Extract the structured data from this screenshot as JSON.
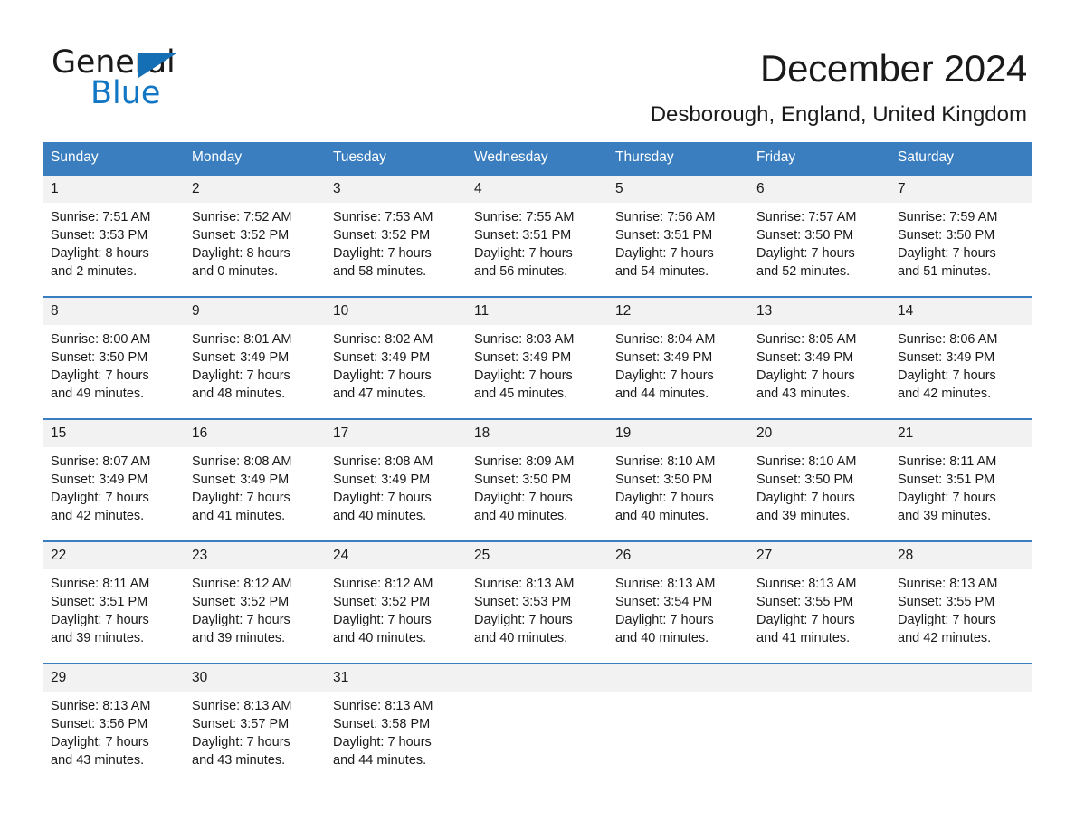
{
  "brand": {
    "name_part1": "General",
    "name_part2": "Blue",
    "accent_color": "#1176c4",
    "triangle_color": "#156fb5"
  },
  "header": {
    "title": "December 2024",
    "subtitle": "Desborough, England, United Kingdom"
  },
  "calendar": {
    "header_bg": "#3a7ebf",
    "daynum_bg": "#f2f2f2",
    "weekday_headers": [
      "Sunday",
      "Monday",
      "Tuesday",
      "Wednesday",
      "Thursday",
      "Friday",
      "Saturday"
    ],
    "weeks": [
      [
        {
          "day": "1",
          "sunrise": "Sunrise: 7:51 AM",
          "sunset": "Sunset: 3:53 PM",
          "daylight_line1": "Daylight: 8 hours",
          "daylight_line2": "and 2 minutes."
        },
        {
          "day": "2",
          "sunrise": "Sunrise: 7:52 AM",
          "sunset": "Sunset: 3:52 PM",
          "daylight_line1": "Daylight: 8 hours",
          "daylight_line2": "and 0 minutes."
        },
        {
          "day": "3",
          "sunrise": "Sunrise: 7:53 AM",
          "sunset": "Sunset: 3:52 PM",
          "daylight_line1": "Daylight: 7 hours",
          "daylight_line2": "and 58 minutes."
        },
        {
          "day": "4",
          "sunrise": "Sunrise: 7:55 AM",
          "sunset": "Sunset: 3:51 PM",
          "daylight_line1": "Daylight: 7 hours",
          "daylight_line2": "and 56 minutes."
        },
        {
          "day": "5",
          "sunrise": "Sunrise: 7:56 AM",
          "sunset": "Sunset: 3:51 PM",
          "daylight_line1": "Daylight: 7 hours",
          "daylight_line2": "and 54 minutes."
        },
        {
          "day": "6",
          "sunrise": "Sunrise: 7:57 AM",
          "sunset": "Sunset: 3:50 PM",
          "daylight_line1": "Daylight: 7 hours",
          "daylight_line2": "and 52 minutes."
        },
        {
          "day": "7",
          "sunrise": "Sunrise: 7:59 AM",
          "sunset": "Sunset: 3:50 PM",
          "daylight_line1": "Daylight: 7 hours",
          "daylight_line2": "and 51 minutes."
        }
      ],
      [
        {
          "day": "8",
          "sunrise": "Sunrise: 8:00 AM",
          "sunset": "Sunset: 3:50 PM",
          "daylight_line1": "Daylight: 7 hours",
          "daylight_line2": "and 49 minutes."
        },
        {
          "day": "9",
          "sunrise": "Sunrise: 8:01 AM",
          "sunset": "Sunset: 3:49 PM",
          "daylight_line1": "Daylight: 7 hours",
          "daylight_line2": "and 48 minutes."
        },
        {
          "day": "10",
          "sunrise": "Sunrise: 8:02 AM",
          "sunset": "Sunset: 3:49 PM",
          "daylight_line1": "Daylight: 7 hours",
          "daylight_line2": "and 47 minutes."
        },
        {
          "day": "11",
          "sunrise": "Sunrise: 8:03 AM",
          "sunset": "Sunset: 3:49 PM",
          "daylight_line1": "Daylight: 7 hours",
          "daylight_line2": "and 45 minutes."
        },
        {
          "day": "12",
          "sunrise": "Sunrise: 8:04 AM",
          "sunset": "Sunset: 3:49 PM",
          "daylight_line1": "Daylight: 7 hours",
          "daylight_line2": "and 44 minutes."
        },
        {
          "day": "13",
          "sunrise": "Sunrise: 8:05 AM",
          "sunset": "Sunset: 3:49 PM",
          "daylight_line1": "Daylight: 7 hours",
          "daylight_line2": "and 43 minutes."
        },
        {
          "day": "14",
          "sunrise": "Sunrise: 8:06 AM",
          "sunset": "Sunset: 3:49 PM",
          "daylight_line1": "Daylight: 7 hours",
          "daylight_line2": "and 42 minutes."
        }
      ],
      [
        {
          "day": "15",
          "sunrise": "Sunrise: 8:07 AM",
          "sunset": "Sunset: 3:49 PM",
          "daylight_line1": "Daylight: 7 hours",
          "daylight_line2": "and 42 minutes."
        },
        {
          "day": "16",
          "sunrise": "Sunrise: 8:08 AM",
          "sunset": "Sunset: 3:49 PM",
          "daylight_line1": "Daylight: 7 hours",
          "daylight_line2": "and 41 minutes."
        },
        {
          "day": "17",
          "sunrise": "Sunrise: 8:08 AM",
          "sunset": "Sunset: 3:49 PM",
          "daylight_line1": "Daylight: 7 hours",
          "daylight_line2": "and 40 minutes."
        },
        {
          "day": "18",
          "sunrise": "Sunrise: 8:09 AM",
          "sunset": "Sunset: 3:50 PM",
          "daylight_line1": "Daylight: 7 hours",
          "daylight_line2": "and 40 minutes."
        },
        {
          "day": "19",
          "sunrise": "Sunrise: 8:10 AM",
          "sunset": "Sunset: 3:50 PM",
          "daylight_line1": "Daylight: 7 hours",
          "daylight_line2": "and 40 minutes."
        },
        {
          "day": "20",
          "sunrise": "Sunrise: 8:10 AM",
          "sunset": "Sunset: 3:50 PM",
          "daylight_line1": "Daylight: 7 hours",
          "daylight_line2": "and 39 minutes."
        },
        {
          "day": "21",
          "sunrise": "Sunrise: 8:11 AM",
          "sunset": "Sunset: 3:51 PM",
          "daylight_line1": "Daylight: 7 hours",
          "daylight_line2": "and 39 minutes."
        }
      ],
      [
        {
          "day": "22",
          "sunrise": "Sunrise: 8:11 AM",
          "sunset": "Sunset: 3:51 PM",
          "daylight_line1": "Daylight: 7 hours",
          "daylight_line2": "and 39 minutes."
        },
        {
          "day": "23",
          "sunrise": "Sunrise: 8:12 AM",
          "sunset": "Sunset: 3:52 PM",
          "daylight_line1": "Daylight: 7 hours",
          "daylight_line2": "and 39 minutes."
        },
        {
          "day": "24",
          "sunrise": "Sunrise: 8:12 AM",
          "sunset": "Sunset: 3:52 PM",
          "daylight_line1": "Daylight: 7 hours",
          "daylight_line2": "and 40 minutes."
        },
        {
          "day": "25",
          "sunrise": "Sunrise: 8:13 AM",
          "sunset": "Sunset: 3:53 PM",
          "daylight_line1": "Daylight: 7 hours",
          "daylight_line2": "and 40 minutes."
        },
        {
          "day": "26",
          "sunrise": "Sunrise: 8:13 AM",
          "sunset": "Sunset: 3:54 PM",
          "daylight_line1": "Daylight: 7 hours",
          "daylight_line2": "and 40 minutes."
        },
        {
          "day": "27",
          "sunrise": "Sunrise: 8:13 AM",
          "sunset": "Sunset: 3:55 PM",
          "daylight_line1": "Daylight: 7 hours",
          "daylight_line2": "and 41 minutes."
        },
        {
          "day": "28",
          "sunrise": "Sunrise: 8:13 AM",
          "sunset": "Sunset: 3:55 PM",
          "daylight_line1": "Daylight: 7 hours",
          "daylight_line2": "and 42 minutes."
        }
      ],
      [
        {
          "day": "29",
          "sunrise": "Sunrise: 8:13 AM",
          "sunset": "Sunset: 3:56 PM",
          "daylight_line1": "Daylight: 7 hours",
          "daylight_line2": "and 43 minutes."
        },
        {
          "day": "30",
          "sunrise": "Sunrise: 8:13 AM",
          "sunset": "Sunset: 3:57 PM",
          "daylight_line1": "Daylight: 7 hours",
          "daylight_line2": "and 43 minutes."
        },
        {
          "day": "31",
          "sunrise": "Sunrise: 8:13 AM",
          "sunset": "Sunset: 3:58 PM",
          "daylight_line1": "Daylight: 7 hours",
          "daylight_line2": "and 44 minutes."
        },
        {
          "day": "",
          "sunrise": "",
          "sunset": "",
          "daylight_line1": "",
          "daylight_line2": ""
        },
        {
          "day": "",
          "sunrise": "",
          "sunset": "",
          "daylight_line1": "",
          "daylight_line2": ""
        },
        {
          "day": "",
          "sunrise": "",
          "sunset": "",
          "daylight_line1": "",
          "daylight_line2": ""
        },
        {
          "day": "",
          "sunrise": "",
          "sunset": "",
          "daylight_line1": "",
          "daylight_line2": ""
        }
      ]
    ]
  }
}
